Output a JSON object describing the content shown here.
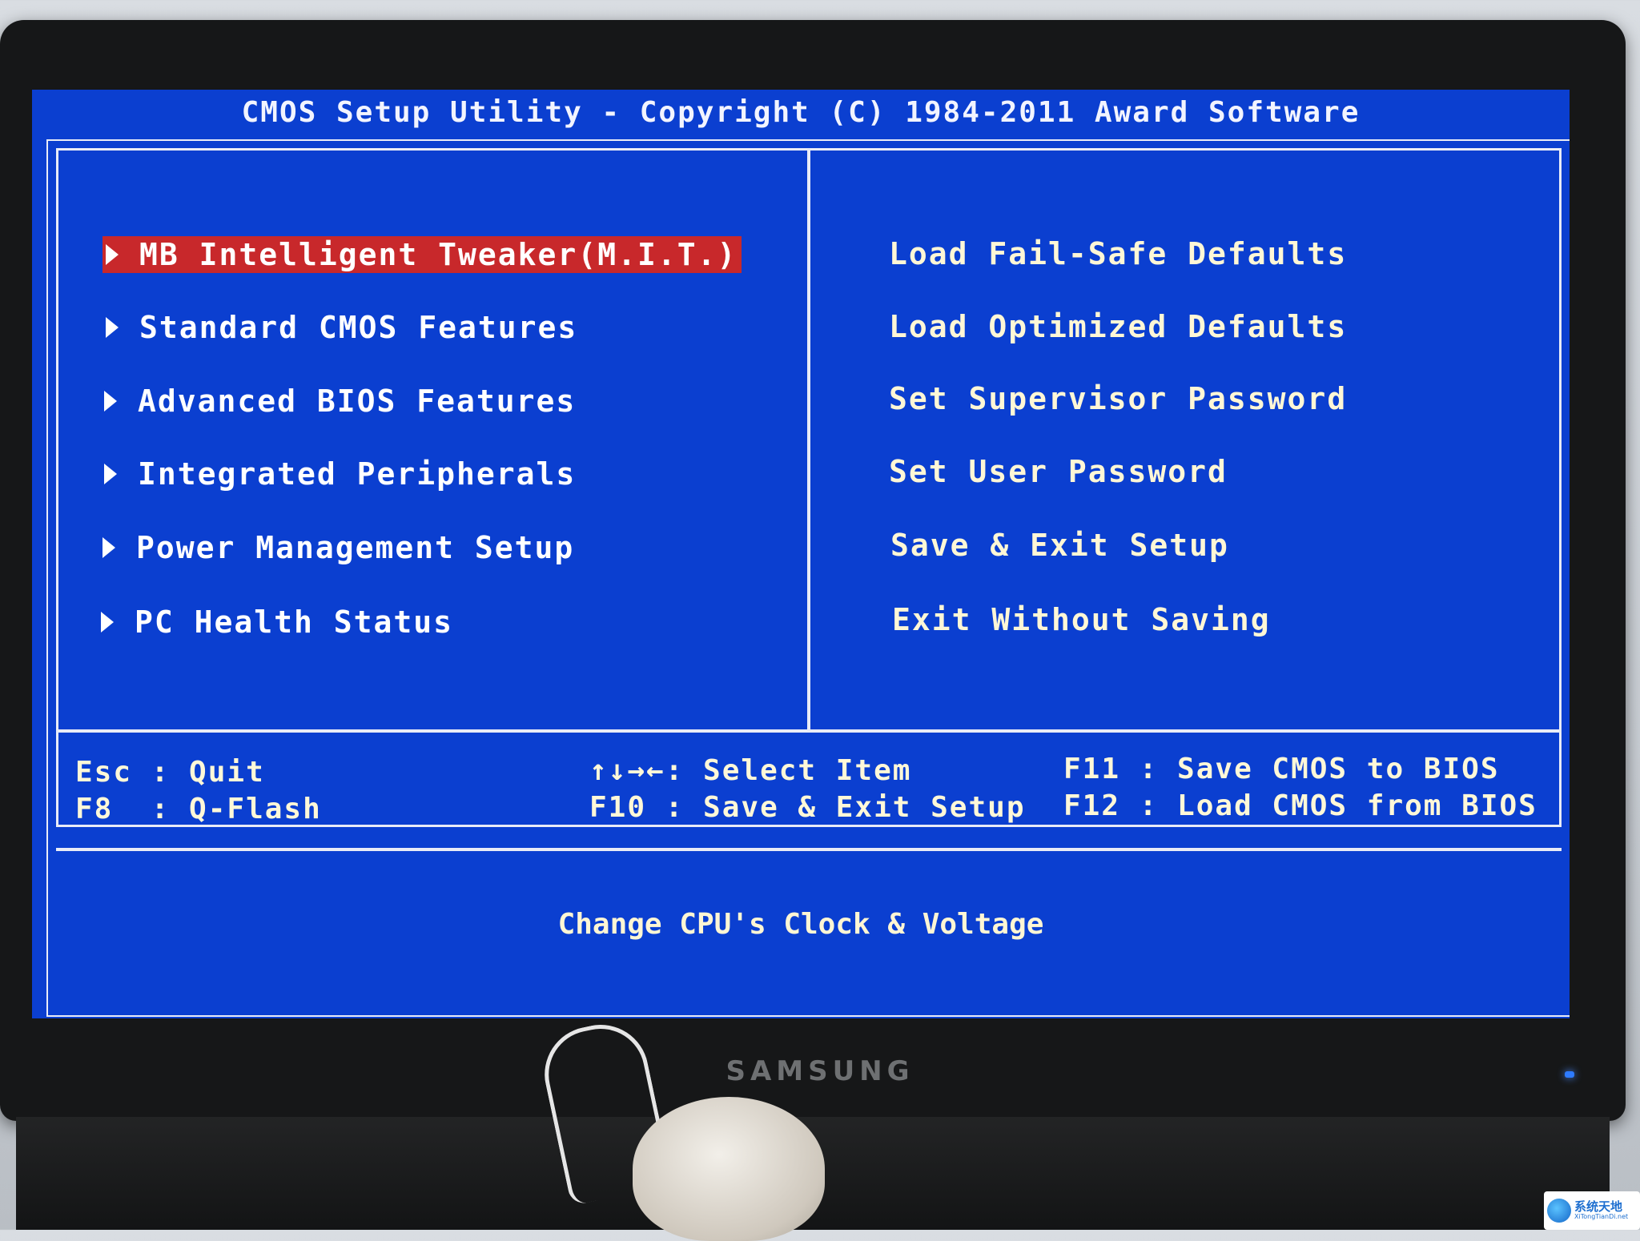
{
  "bios": {
    "title": "CMOS Setup Utility - Copyright (C) 1984-2011 Award Software",
    "left_menu": [
      {
        "label": "MB Intelligent Tweaker(M.I.T.)",
        "selected": true
      },
      {
        "label": "Standard CMOS Features",
        "selected": false
      },
      {
        "label": "Advanced BIOS Features",
        "selected": false
      },
      {
        "label": "Integrated Peripherals",
        "selected": false
      },
      {
        "label": "Power Management Setup",
        "selected": false
      },
      {
        "label": "PC Health Status",
        "selected": false
      }
    ],
    "right_menu": [
      {
        "label": "Load Fail-Safe Defaults"
      },
      {
        "label": "Load Optimized Defaults"
      },
      {
        "label": "Set Supervisor Password"
      },
      {
        "label": "Set User Password"
      },
      {
        "label": "Save & Exit Setup"
      },
      {
        "label": "Exit Without Saving"
      }
    ],
    "help_keys": {
      "esc": "Esc : Quit",
      "f8": "F8  : Q-Flash",
      "arrows": "↑↓→←: Select Item",
      "f10": "F10 : Save & Exit Setup",
      "f11": "F11 : Save CMOS to BIOS",
      "f12": "F12 : Load CMOS from BIOS"
    },
    "status_line": "Change CPU's Clock & Voltage",
    "colors": {
      "background": "#0b3fd0",
      "selection": "#c8282b",
      "text": "#ffffff"
    }
  },
  "monitor": {
    "brand": "SAMSUNG"
  },
  "watermark": {
    "text": "系统天地",
    "sub": "XiTongTianDi.net"
  }
}
